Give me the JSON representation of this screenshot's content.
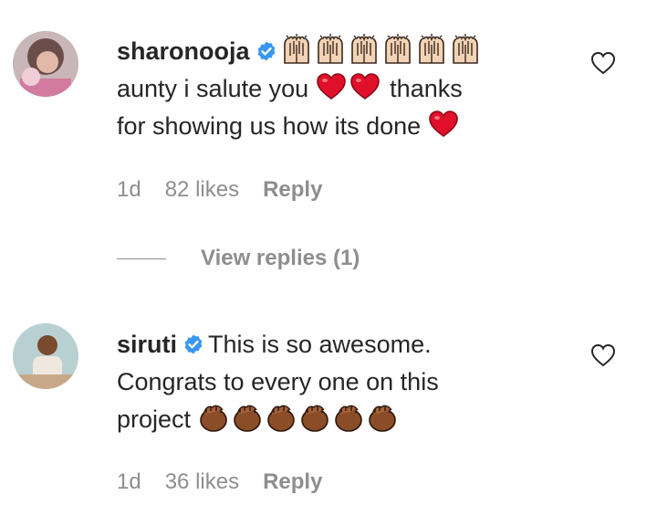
{
  "comments": [
    {
      "username": "sharonooja",
      "verified": true,
      "text_line1": "aunty i salute you",
      "text_line1b": "thanks",
      "text_line2": "for showing us how its done",
      "emojis_after_name": [
        "raising-hands",
        "raising-hands",
        "raising-hands",
        "raising-hands",
        "raising-hands",
        "raising-hands"
      ],
      "time": "1d",
      "likes": "82 likes",
      "reply": "Reply"
    },
    {
      "username": "siruti",
      "verified": true,
      "text_inline": "This is so awesome.",
      "text_line2": "Congrats to every one on this",
      "text_line3": "project",
      "emojis_after_text": [
        "clapping-hands",
        "clapping-hands",
        "clapping-hands",
        "clapping-hands",
        "clapping-hands",
        "clapping-hands"
      ],
      "time": "1d",
      "likes": "36 likes",
      "reply": "Reply"
    }
  ],
  "view_replies": "View replies (1)",
  "colors": {
    "text": "#262626",
    "secondary": "#8e8e8e",
    "verified": "#3897f0",
    "heart_emoji": "#e0102a",
    "raising_hands_skin": "#f3d3b5",
    "clapping_hands_skin": "#8a4d27"
  }
}
